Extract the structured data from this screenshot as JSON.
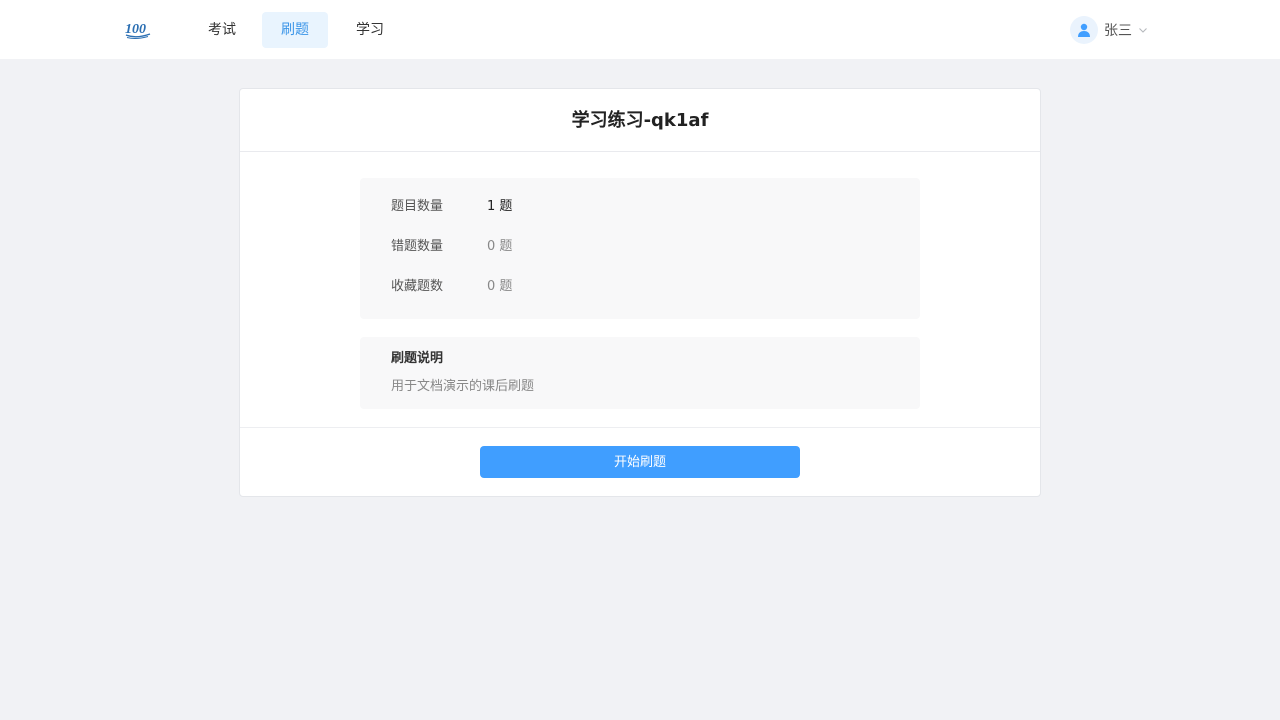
{
  "header": {
    "logo_text": "100",
    "nav": [
      {
        "label": "考试",
        "active": false
      },
      {
        "label": "刷题",
        "active": true
      },
      {
        "label": "学习",
        "active": false
      }
    ],
    "user": {
      "name": "张三",
      "avatar_icon": "user-icon",
      "menu_icon": "chevron-down-icon"
    }
  },
  "practice": {
    "title": "学习练习-qk1af",
    "stats": [
      {
        "label": "题目数量",
        "value": "1 题"
      },
      {
        "label": "错题数量",
        "value": "0 题"
      },
      {
        "label": "收藏题数",
        "value": "0 题"
      }
    ],
    "description": {
      "heading": "刷题说明",
      "text": "用于文档演示的课后刷题"
    },
    "start_button_label": "开始刷题"
  },
  "colors": {
    "accent": "#409eff",
    "nav_active_bg": "#e9f4fe",
    "nav_active_text": "#3b95e8",
    "page_bg": "#f1f2f5"
  }
}
